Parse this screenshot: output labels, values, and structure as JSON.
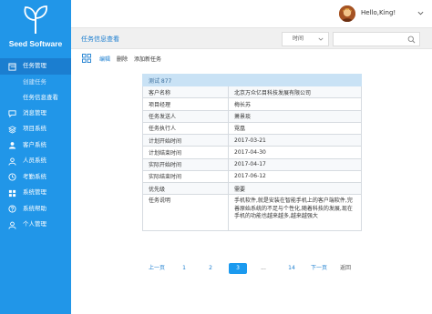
{
  "app": {
    "brand": "Seed Software"
  },
  "user": {
    "greeting": "Hello,King!"
  },
  "sidebar": {
    "items": [
      {
        "label": "任务管理",
        "icon": "task-icon",
        "active": true
      },
      {
        "label": "消息管理",
        "icon": "message-icon"
      },
      {
        "label": "项目系统",
        "icon": "project-icon"
      },
      {
        "label": "客户系统",
        "icon": "customer-icon"
      },
      {
        "label": "人员系统",
        "icon": "people-icon"
      },
      {
        "label": "考勤系统",
        "icon": "attendance-icon"
      },
      {
        "label": "系统管理",
        "icon": "system-icon"
      },
      {
        "label": "系统帮助",
        "icon": "help-icon"
      },
      {
        "label": "个人管理",
        "icon": "user-icon"
      }
    ],
    "subitems": [
      {
        "label": "创建任务"
      },
      {
        "label": "任务信息查看",
        "current": true
      }
    ]
  },
  "subbar": {
    "title": "任务信息查看",
    "time_label": "时间"
  },
  "toolbar": {
    "edit": "编辑",
    "delete": "删除",
    "add": "添加新任务"
  },
  "detail": {
    "header": "测试 877",
    "rows": [
      {
        "k": "客户名称",
        "v": "北京万众亿目科技发展有限公司"
      },
      {
        "k": "项目经理",
        "v": "梅长苏"
      },
      {
        "k": "任务发送人",
        "v": "萧景琰"
      },
      {
        "k": "任务执行人",
        "v": "霓凰"
      },
      {
        "k": "计划开始时间",
        "v": "2017-03-21"
      },
      {
        "k": "计划结束时间",
        "v": "2017-04-30"
      },
      {
        "k": "实际开始时间",
        "v": "2017-04-17"
      },
      {
        "k": "实际结束时间",
        "v": "2017-06-12"
      },
      {
        "k": "优先级",
        "v": "需要"
      }
    ],
    "desc_key": "任务说明",
    "desc_value": "手机软件,就是安装在智能手机上的客户端软件,完善原始系统的不足与个性化,随着科技的发展,现在手机的功能也越来越多,越来越强大"
  },
  "pager": {
    "prev": "上一页",
    "pages": [
      "1",
      "2",
      "3",
      "...",
      "14"
    ],
    "current": "3",
    "next": "下一页",
    "back": "返回"
  },
  "colors": {
    "accent": "#2196e8",
    "accent_dark": "#1b7ed0",
    "table_header": "#c9e2f5"
  }
}
